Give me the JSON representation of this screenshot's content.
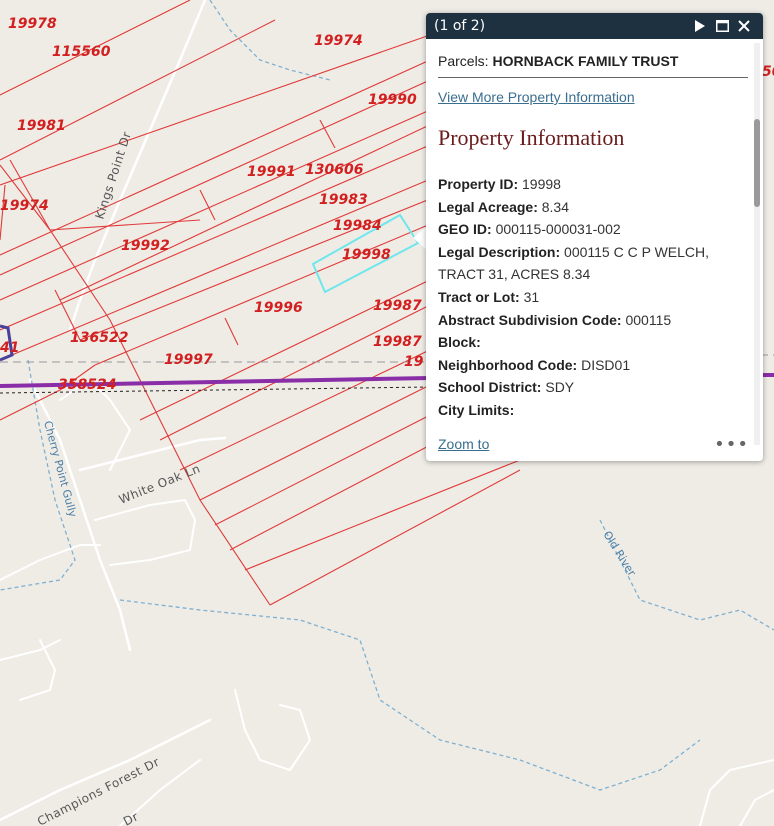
{
  "map": {
    "parcel_labels": [
      "19978",
      "115560",
      "19974",
      "19990",
      "19981",
      "19991",
      "130606",
      "19974",
      "19983",
      "19984",
      "19992",
      "19998",
      "19996",
      "19987",
      "136522",
      "19997",
      "19987",
      "358524",
      "41",
      "19",
      "50"
    ],
    "road_labels": [
      "Kings Point Dr",
      "White Oak Ln",
      "Champions Forest Dr",
      "Dr"
    ],
    "water_labels": [
      "Cherry Point Gully",
      "Old River"
    ],
    "colors": {
      "parcel_line": "#e03a3a",
      "parcel_text": "#d21f1f",
      "selected_parcel": "#6fe6ec",
      "boundary": "#8a2ea8",
      "water": "#7fb0d0",
      "road": "#ffffff"
    }
  },
  "popup": {
    "count": "(1 of 2)",
    "icons": [
      "play-icon",
      "maximize-icon",
      "close-icon"
    ],
    "title_label": "Parcels:",
    "title_value": "HORNBACK FAMILY TRUST",
    "more_link": "View More Property Information",
    "section_title": "Property Information",
    "fields": [
      {
        "label": "Property ID:",
        "value": "19998"
      },
      {
        "label": "Legal Acreage:",
        "value": "8.34"
      },
      {
        "label": "GEO ID:",
        "value": "000115-000031-002"
      },
      {
        "label": "Legal Description:",
        "value": "000115 C C P WELCH, TRACT 31, ACRES 8.34"
      },
      {
        "label": "Tract or Lot:",
        "value": "31"
      },
      {
        "label": "Abstract Subdivision Code:",
        "value": "000115"
      },
      {
        "label": "Block:",
        "value": ""
      },
      {
        "label": "Neighborhood Code:",
        "value": "DISD01"
      },
      {
        "label": "School District:",
        "value": "SDY"
      },
      {
        "label": "City Limits:",
        "value": ""
      }
    ],
    "zoom_link": "Zoom to",
    "more_options": "•••"
  }
}
